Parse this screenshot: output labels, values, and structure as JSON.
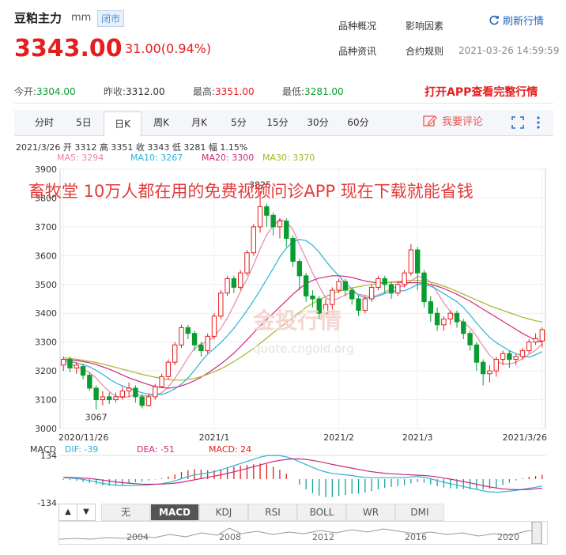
{
  "header": {
    "name": "豆粕主力",
    "unit": "mm",
    "status": "闭市",
    "links": [
      "品种概况",
      "影响因素",
      "品种资讯",
      "合约规则"
    ],
    "refresh": "刷新行情",
    "price": "3343.00",
    "change": "31.00(0.94%)",
    "time": "2021-03-26 14:59:59"
  },
  "stats": {
    "open_label": "今开:",
    "open": "3304.00",
    "prev_label": "昨收:",
    "prev": "3312.00",
    "high_label": "最高:",
    "high": "3351.00",
    "low_label": "最低:",
    "low": "3281.00",
    "open_app": "打开APP查看完整行情"
  },
  "tabs": [
    "分时",
    "5日",
    "日K",
    "周K",
    "月K",
    "5分",
    "15分",
    "30分",
    "60分"
  ],
  "active_tab": "日K",
  "comment_label": "我要评论",
  "info_line": "2021/3/26 开 3312 高 3351 收 3343 低 3281 幅 1.15%",
  "ma_labels": [
    {
      "text": "MA5: 3294",
      "color": "#e986a6"
    },
    {
      "text": "MA10: 3267",
      "color": "#29b2d6"
    },
    {
      "text": "MA20: 3300",
      "color": "#d3267c"
    },
    {
      "text": "MA30: 3370",
      "color": "#a2b62a"
    }
  ],
  "ad_text": "畜牧堂 10万人都在用的免费视频问诊APP 现在下载就能省钱",
  "watermark": {
    "logo": "金投行情",
    "url": "quote.cngold.org"
  },
  "macd_labels": {
    "title": "MACD",
    "dif": "DIF: -39",
    "dea": "DEA: -51",
    "macd": "MACD: 24"
  },
  "bottom_tabs": [
    "无",
    "MACD",
    "KDJ",
    "RSI",
    "BOLL",
    "WR",
    "DMI"
  ],
  "bottom_active": "MACD",
  "arrows": [
    "▲",
    "▼"
  ],
  "overview_years": [
    "2004",
    "2008",
    "2012",
    "2016",
    "2020"
  ],
  "colors": {
    "up": "#e41d1d",
    "down": "#0a9c30",
    "ma5": "#e986a6",
    "ma10": "#29b2d6",
    "ma20": "#d3267c",
    "ma30": "#a2b62a"
  },
  "chart_data": {
    "type": "candlestick",
    "ylim": [
      3000,
      3900
    ],
    "yticks": [
      3000,
      3100,
      3200,
      3300,
      3400,
      3500,
      3600,
      3700,
      3800,
      3900
    ],
    "xticks": [
      {
        "label": "2020/11/26",
        "index": 0
      },
      {
        "label": "2021/1",
        "index": 23
      },
      {
        "label": "2021/2",
        "index": 42
      },
      {
        "label": "2021/3",
        "index": 54
      },
      {
        "label": "2021/3/26",
        "index": 73
      }
    ],
    "annotations": [
      {
        "text": "3825",
        "index": 30,
        "value": 3825
      },
      {
        "text": "3067",
        "index": 5,
        "value": 3067
      }
    ],
    "candles": [
      [
        3220,
        3240,
        3200,
        3250
      ],
      [
        3240,
        3210,
        3195,
        3250
      ],
      [
        3210,
        3220,
        3190,
        3230
      ],
      [
        3215,
        3185,
        3170,
        3225
      ],
      [
        3185,
        3140,
        3130,
        3195
      ],
      [
        3140,
        3100,
        3067,
        3150
      ],
      [
        3100,
        3110,
        3080,
        3130
      ],
      [
        3110,
        3100,
        3085,
        3125
      ],
      [
        3100,
        3110,
        3090,
        3125
      ],
      [
        3110,
        3130,
        3100,
        3145
      ],
      [
        3130,
        3140,
        3110,
        3160
      ],
      [
        3140,
        3110,
        3090,
        3150
      ],
      [
        3110,
        3080,
        3070,
        3120
      ],
      [
        3080,
        3110,
        3075,
        3120
      ],
      [
        3110,
        3145,
        3100,
        3155
      ],
      [
        3145,
        3180,
        3140,
        3190
      ],
      [
        3180,
        3230,
        3170,
        3240
      ],
      [
        3230,
        3290,
        3220,
        3300
      ],
      [
        3290,
        3350,
        3280,
        3360
      ],
      [
        3350,
        3330,
        3310,
        3360
      ],
      [
        3330,
        3290,
        3270,
        3340
      ],
      [
        3290,
        3270,
        3250,
        3300
      ],
      [
        3270,
        3320,
        3260,
        3330
      ],
      [
        3320,
        3390,
        3310,
        3400
      ],
      [
        3390,
        3470,
        3380,
        3480
      ],
      [
        3470,
        3520,
        3460,
        3530
      ],
      [
        3520,
        3490,
        3470,
        3530
      ],
      [
        3490,
        3540,
        3480,
        3550
      ],
      [
        3540,
        3610,
        3530,
        3620
      ],
      [
        3610,
        3700,
        3600,
        3710
      ],
      [
        3700,
        3770,
        3680,
        3825
      ],
      [
        3770,
        3740,
        3700,
        3780
      ],
      [
        3740,
        3700,
        3670,
        3750
      ],
      [
        3700,
        3720,
        3660,
        3730
      ],
      [
        3720,
        3660,
        3630,
        3730
      ],
      [
        3660,
        3580,
        3560,
        3670
      ],
      [
        3580,
        3530,
        3480,
        3590
      ],
      [
        3530,
        3460,
        3440,
        3540
      ],
      [
        3460,
        3450,
        3420,
        3480
      ],
      [
        3450,
        3400,
        3380,
        3460
      ],
      [
        3400,
        3430,
        3390,
        3450
      ],
      [
        3430,
        3480,
        3410,
        3490
      ],
      [
        3480,
        3510,
        3470,
        3520
      ],
      [
        3510,
        3480,
        3460,
        3520
      ],
      [
        3480,
        3450,
        3430,
        3490
      ],
      [
        3450,
        3410,
        3390,
        3460
      ],
      [
        3410,
        3450,
        3400,
        3460
      ],
      [
        3450,
        3490,
        3440,
        3500
      ],
      [
        3490,
        3520,
        3480,
        3530
      ],
      [
        3520,
        3500,
        3470,
        3530
      ],
      [
        3500,
        3470,
        3450,
        3510
      ],
      [
        3470,
        3500,
        3460,
        3510
      ],
      [
        3500,
        3540,
        3490,
        3550
      ],
      [
        3540,
        3620,
        3530,
        3640
      ],
      [
        3620,
        3540,
        3480,
        3630
      ],
      [
        3540,
        3440,
        3420,
        3550
      ],
      [
        3440,
        3400,
        3370,
        3460
      ],
      [
        3400,
        3360,
        3340,
        3420
      ],
      [
        3360,
        3380,
        3340,
        3390
      ],
      [
        3380,
        3400,
        3360,
        3410
      ],
      [
        3400,
        3370,
        3350,
        3410
      ],
      [
        3370,
        3330,
        3310,
        3380
      ],
      [
        3330,
        3290,
        3270,
        3340
      ],
      [
        3290,
        3230,
        3200,
        3300
      ],
      [
        3230,
        3190,
        3150,
        3240
      ],
      [
        3190,
        3200,
        3160,
        3220
      ],
      [
        3200,
        3240,
        3180,
        3250
      ],
      [
        3240,
        3260,
        3220,
        3270
      ],
      [
        3260,
        3240,
        3210,
        3270
      ],
      [
        3240,
        3250,
        3220,
        3260
      ],
      [
        3250,
        3270,
        3240,
        3280
      ],
      [
        3270,
        3300,
        3260,
        3310
      ],
      [
        3300,
        3312,
        3290,
        3330
      ],
      [
        3304,
        3343,
        3281,
        3351
      ]
    ],
    "ma": [
      {
        "name": "MA5",
        "color": "#e986a6",
        "values": [
          3230,
          3225,
          3215,
          3205,
          3195,
          3175,
          3150,
          3128,
          3112,
          3108,
          3110,
          3118,
          3114,
          3114,
          3116,
          3124,
          3144,
          3174,
          3208,
          3246,
          3278,
          3294,
          3302,
          3320,
          3348,
          3384,
          3428,
          3476,
          3518,
          3568,
          3624,
          3672,
          3704,
          3726,
          3718,
          3690,
          3638,
          3590,
          3540,
          3494,
          3454,
          3444,
          3452,
          3464,
          3474,
          3466,
          3462,
          3456,
          3464,
          3474,
          3486,
          3492,
          3494,
          3512,
          3528,
          3524,
          3508,
          3472,
          3436,
          3406,
          3382,
          3368,
          3350,
          3320,
          3286,
          3254,
          3234,
          3224,
          3224,
          3230,
          3242,
          3258,
          3272,
          3294
        ]
      },
      {
        "name": "MA10",
        "color": "#29b2d6",
        "values": [
          3235,
          3232,
          3228,
          3222,
          3214,
          3202,
          3188,
          3172,
          3158,
          3148,
          3140,
          3132,
          3124,
          3120,
          3118,
          3118,
          3126,
          3138,
          3154,
          3176,
          3202,
          3232,
          3258,
          3278,
          3298,
          3322,
          3348,
          3378,
          3410,
          3444,
          3480,
          3518,
          3556,
          3596,
          3626,
          3648,
          3656,
          3652,
          3636,
          3612,
          3582,
          3554,
          3530,
          3504,
          3484,
          3462,
          3454,
          3454,
          3460,
          3468,
          3476,
          3478,
          3478,
          3488,
          3500,
          3500,
          3494,
          3482,
          3468,
          3454,
          3440,
          3420,
          3394,
          3366,
          3340,
          3316,
          3298,
          3284,
          3270,
          3260,
          3252,
          3248,
          3256,
          3267
        ]
      },
      {
        "name": "MA20",
        "color": "#d3267c",
        "values": [
          3240,
          3238,
          3236,
          3232,
          3228,
          3222,
          3214,
          3206,
          3196,
          3186,
          3176,
          3168,
          3160,
          3152,
          3146,
          3142,
          3140,
          3142,
          3148,
          3156,
          3166,
          3178,
          3192,
          3208,
          3224,
          3242,
          3262,
          3284,
          3308,
          3332,
          3356,
          3378,
          3400,
          3422,
          3444,
          3466,
          3486,
          3502,
          3514,
          3522,
          3526,
          3530,
          3530,
          3528,
          3524,
          3518,
          3512,
          3508,
          3506,
          3506,
          3508,
          3508,
          3506,
          3506,
          3506,
          3504,
          3500,
          3494,
          3486,
          3476,
          3466,
          3454,
          3442,
          3428,
          3414,
          3400,
          3386,
          3372,
          3358,
          3344,
          3330,
          3318,
          3306,
          3300
        ]
      },
      {
        "name": "MA30",
        "color": "#a2b62a",
        "values": [
          3245,
          3243,
          3240,
          3237,
          3233,
          3229,
          3224,
          3218,
          3212,
          3206,
          3200,
          3194,
          3188,
          3183,
          3178,
          3174,
          3170,
          3168,
          3168,
          3170,
          3174,
          3180,
          3188,
          3197,
          3207,
          3219,
          3232,
          3247,
          3262,
          3278,
          3296,
          3314,
          3332,
          3350,
          3368,
          3386,
          3404,
          3420,
          3434,
          3446,
          3458,
          3468,
          3476,
          3482,
          3488,
          3492,
          3496,
          3500,
          3503,
          3506,
          3508,
          3510,
          3512,
          3514,
          3514,
          3512,
          3508,
          3502,
          3494,
          3486,
          3476,
          3466,
          3456,
          3446,
          3436,
          3426,
          3418,
          3410,
          3402,
          3394,
          3386,
          3380,
          3374,
          3370
        ]
      }
    ],
    "macd": {
      "ylim": [
        -134,
        134
      ],
      "yticks": [
        134,
        -134
      ],
      "dif": [
        8,
        6,
        3,
        -2,
        -8,
        -16,
        -24,
        -30,
        -34,
        -36,
        -36,
        -35,
        -35,
        -33,
        -30,
        -26,
        -19,
        -10,
        2,
        14,
        24,
        30,
        35,
        42,
        52,
        64,
        76,
        88,
        100,
        112,
        124,
        132,
        134,
        132,
        126,
        114,
        98,
        82,
        66,
        52,
        40,
        32,
        28,
        24,
        20,
        14,
        10,
        8,
        8,
        8,
        8,
        8,
        9,
        12,
        14,
        10,
        2,
        -8,
        -18,
        -26,
        -34,
        -42,
        -50,
        -58,
        -66,
        -72,
        -74,
        -72,
        -68,
        -64,
        -58,
        -52,
        -46,
        -39
      ],
      "dea": [
        10,
        9,
        8,
        6,
        3,
        -1,
        -6,
        -11,
        -16,
        -20,
        -23,
        -26,
        -28,
        -29,
        -29,
        -28,
        -26,
        -23,
        -18,
        -11,
        -4,
        3,
        10,
        17,
        24,
        32,
        41,
        50,
        60,
        70,
        80,
        90,
        99,
        106,
        111,
        114,
        114,
        111,
        106,
        99,
        91,
        83,
        76,
        69,
        62,
        55,
        48,
        42,
        37,
        33,
        30,
        28,
        26,
        24,
        22,
        20,
        17,
        12,
        6,
        0,
        -7,
        -14,
        -21,
        -29,
        -37,
        -44,
        -50,
        -55,
        -58,
        -60,
        -60,
        -58,
        -55,
        -51
      ],
      "hist": [
        -4,
        -6,
        -10,
        -16,
        -22,
        -30,
        -36,
        -38,
        -36,
        -32,
        -26,
        -18,
        -14,
        -8,
        -2,
        4,
        14,
        26,
        40,
        50,
        56,
        54,
        50,
        50,
        56,
        64,
        70,
        76,
        80,
        84,
        88,
        84,
        70,
        52,
        30,
        0,
        -32,
        -58,
        -80,
        -94,
        -102,
        -102,
        -96,
        -90,
        -84,
        -82,
        -76,
        -68,
        -58,
        -50,
        -44,
        -40,
        -34,
        -24,
        -16,
        -20,
        -30,
        -40,
        -48,
        -52,
        -54,
        -56,
        -58,
        -58,
        -58,
        -56,
        -48,
        -34,
        -20,
        -8,
        4,
        12,
        18,
        24
      ]
    }
  }
}
